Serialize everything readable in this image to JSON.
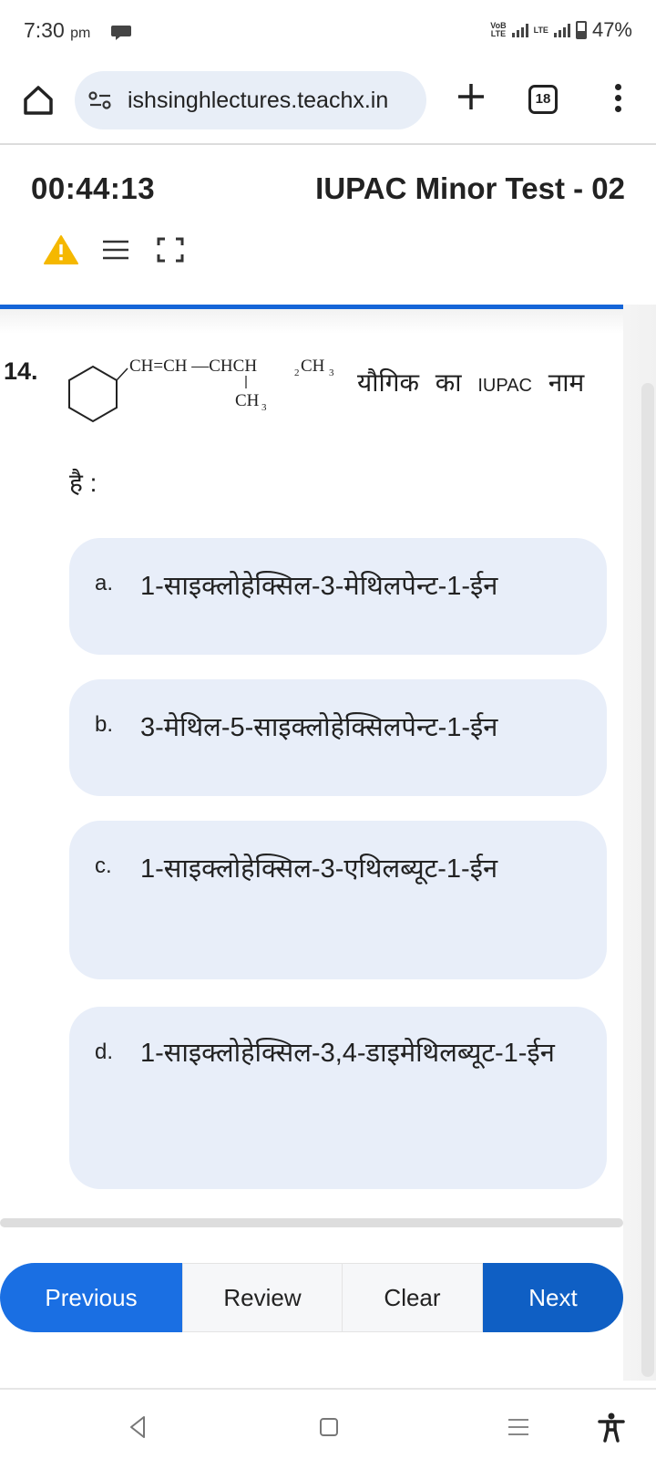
{
  "status_bar": {
    "time": "7:30",
    "ampm": "pm",
    "network_label_top": "VoB",
    "network_label_bottom": "LTE",
    "lte_label": "LTE",
    "battery": "47%"
  },
  "browser": {
    "url": "ishsinghlectures.teachx.in",
    "tab_count": "18"
  },
  "test": {
    "timer": "00:44:13",
    "title": "IUPAC Minor Test - 02"
  },
  "question": {
    "number": "14.",
    "structure": {
      "chain_top": "CH=CH —CHCH",
      "sub2": "2",
      "ch3_end": "CH",
      "sub3": "3",
      "branch": "CH",
      "branch_sub": "3"
    },
    "text_part1": "यौगिक का",
    "text_latin": "IUPAC",
    "text_part2": "नाम",
    "text_line2": "है :"
  },
  "options": [
    {
      "letter": "a.",
      "text": "1-साइक्लोहेक्सिल-3-मेथिलपेन्ट-1-ईन"
    },
    {
      "letter": "b.",
      "text": "3-मेथिल-5-साइक्लोहेक्सिलपेन्ट-1-ईन"
    },
    {
      "letter": "c.",
      "text": "1-साइक्लोहेक्सिल-3-एथिलब्यूट-1-ईन"
    },
    {
      "letter": "d.",
      "text": "1-साइक्लोहेक्सिल-3,4-डाइमेथिलब्यूट-1-ईन"
    }
  ],
  "nav": {
    "previous": "Previous",
    "review": "Review",
    "clear": "Clear",
    "next": "Next"
  },
  "colors": {
    "accent_blue": "#1a6fe3",
    "option_bg": "#e8eef9",
    "warning": "#f5b800"
  },
  "icons": [
    "home-icon",
    "site-info-icon",
    "plus-icon",
    "tabs-icon",
    "more-icon",
    "warning-icon",
    "list-icon",
    "fullscreen-icon",
    "back-icon",
    "home-nav-icon",
    "recents-icon",
    "accessibility-icon"
  ]
}
